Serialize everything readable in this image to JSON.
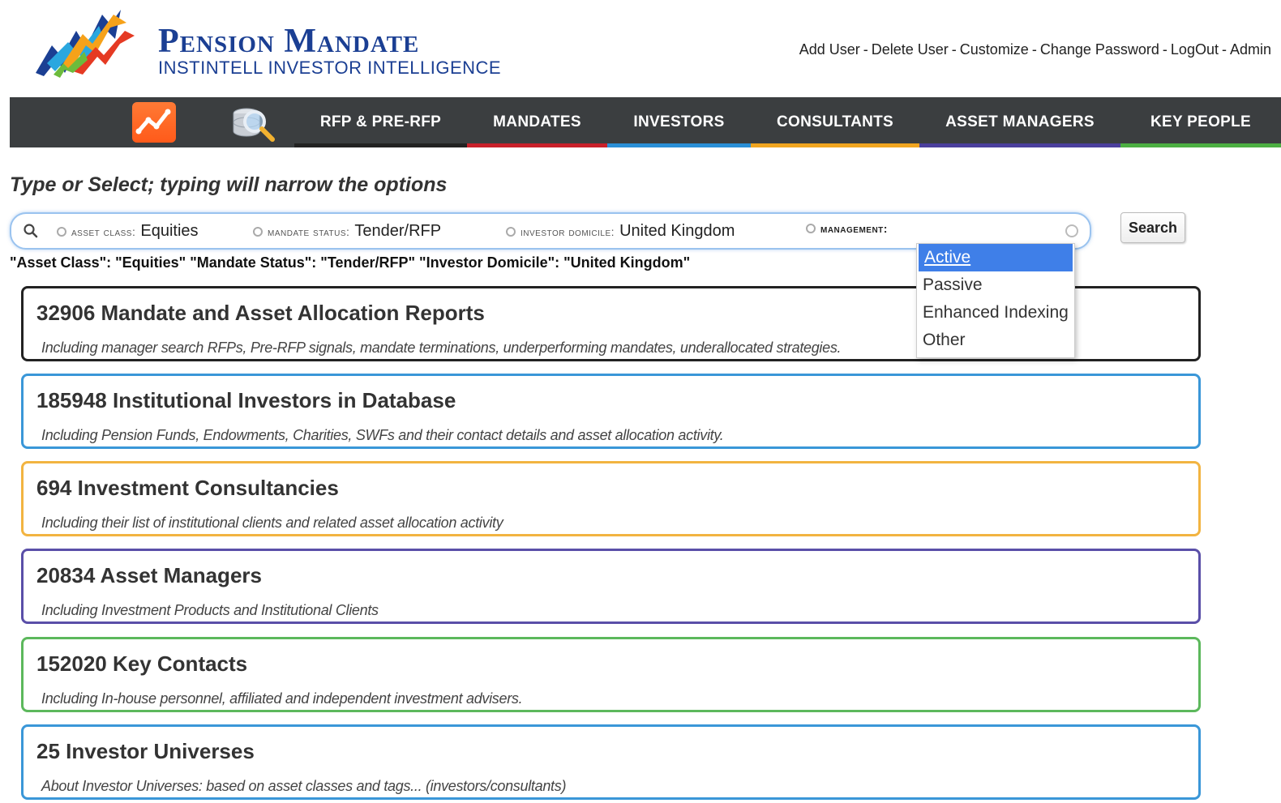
{
  "header": {
    "brand_title": "Pension Mandate",
    "brand_subtitle": "INSTINTELL INVESTOR INTELLIGENCE",
    "user_links": [
      "Add User",
      "Delete User",
      "Customize",
      "Change Password",
      "LogOut",
      "Admin"
    ]
  },
  "nav": {
    "icons": [
      "chart-icon",
      "database-search-icon"
    ],
    "items": [
      {
        "label": "RFP & PRE-RFP",
        "color": "#222222"
      },
      {
        "label": "MANDATES",
        "color": "#c8202a"
      },
      {
        "label": "INVESTORS",
        "color": "#2a8fd6"
      },
      {
        "label": "CONSULTANTS",
        "color": "#f0a520"
      },
      {
        "label": "ASSET MANAGERS",
        "color": "#4b3f9c"
      },
      {
        "label": "KEY PEOPLE",
        "color": "#4caf42"
      }
    ]
  },
  "search": {
    "instructions": "Type or Select; typing will narrow the options",
    "chips": [
      {
        "label": "Asset Class:",
        "value": "Equities"
      },
      {
        "label": "Mandate Status:",
        "value": "Tender/RFP"
      },
      {
        "label": "Investor Domicile:",
        "value": "United Kingdom"
      },
      {
        "label": "Management:",
        "value": ""
      }
    ],
    "button_label": "Search",
    "query_text": "\"Asset Class\": \"Equities\" \"Mandate Status\": \"Tender/RFP\" \"Investor Domicile\": \"United Kingdom\""
  },
  "dropdown": {
    "options": [
      "Active",
      "Passive",
      "Enhanced Indexing",
      "Other"
    ],
    "highlighted": "Active"
  },
  "cards": [
    {
      "title": "32906 Mandate and Asset Allocation Reports",
      "desc": "Including manager search RFPs, Pre-RFP signals, mandate terminations, underperforming mandates, underallocated strategies.",
      "color": "#222222"
    },
    {
      "title": "185948 Institutional Investors in Database",
      "desc": "Including Pension Funds, Endowments, Charities, SWFs and their contact details and asset allocation activity.",
      "color": "#3a97d8"
    },
    {
      "title": "694 Investment Consultancies",
      "desc": "Including their list of institutional clients and related asset allocation activity",
      "color": "#f2b441"
    },
    {
      "title": "20834 Asset Managers",
      "desc": "Including Investment Products and Institutional Clients",
      "color": "#5a4fa8"
    },
    {
      "title": "152020 Key Contacts",
      "desc": "Including In-house personnel, affiliated and independent investment advisers.",
      "color": "#5cb85c"
    },
    {
      "title": "25 Investor Universes",
      "desc": "About Investor Universes: based on asset classes and tags... (investors/consultants)",
      "color": "#3a97d8"
    }
  ]
}
